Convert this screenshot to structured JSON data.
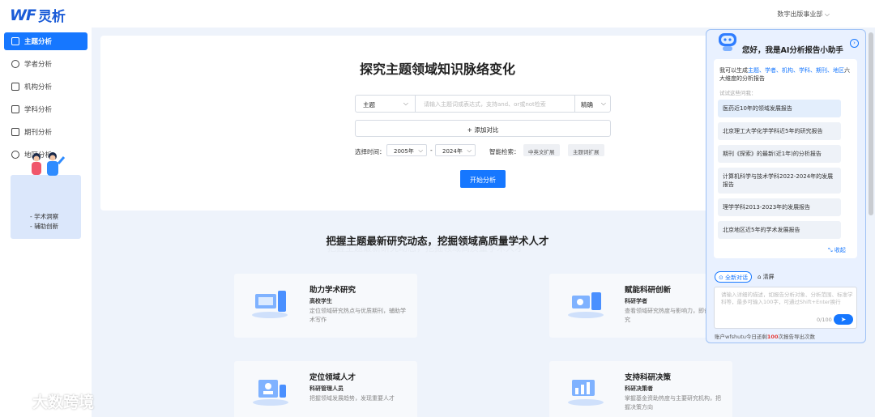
{
  "brand": {
    "logo_wf": "WF",
    "logo_cn": "灵析"
  },
  "header": {
    "dept": "数字出版事业部 ⌵"
  },
  "sidebar": {
    "items": [
      {
        "label": "主题分析",
        "active": true
      },
      {
        "label": "学者分析"
      },
      {
        "label": "机构分析"
      },
      {
        "label": "学科分析"
      },
      {
        "label": "期刊分析"
      },
      {
        "label": "地区分析"
      }
    ],
    "promo": {
      "line1": "- 学术洞察",
      "line2": "- 辅助创新"
    }
  },
  "main": {
    "title": "探究主题领域知识脉络变化",
    "search": {
      "field": "主题",
      "placeholder": "请输入主题词或表达式，支持and、or或not检索",
      "match": "精确"
    },
    "add_compare": "+ 添加对比",
    "time_label": "选择时间：",
    "year_start": "2005年",
    "year_dash": "-",
    "year_end": "2024年",
    "smart_label": "智能检索：",
    "tag1": "中英文扩展",
    "tag2": "主题词扩展",
    "start": "开始分析"
  },
  "section": {
    "title": "把握主题最新研究动态，挖掘领域高质量学术人才",
    "ghost": "把握主题最新研究动态，挖掘领域高质量学术人才"
  },
  "features": [
    {
      "title": "助力学术研究",
      "sub": "高校学生",
      "desc": "定位领域研究热点与优质期刊，辅助学术写作"
    },
    {
      "title": "赋能科研创新",
      "sub": "科研学者",
      "desc": "查看领域研究热度与影响力，即创新研究"
    },
    {
      "title": "定位领域人才",
      "sub": "科研管理人员",
      "desc": "把握领域发展趋势，发现重要人才"
    },
    {
      "title": "支持科研决策",
      "sub": "科研决策者",
      "desc": "掌握基金资助热度与主要研究机构，把握决策方向"
    }
  ],
  "watermark": "大数跨境",
  "ai": {
    "greeting": "您好，我是AI分析报告小助手",
    "intro_pre": "我可以生成",
    "intro_hl1": "主题、学者、机构、学科、期刊、",
    "intro_hl2": "地区",
    "intro_post": "六大维度的分析报告",
    "hint": "试试这些问我：",
    "suggestions": [
      "医药近10年的领域发展报告",
      "北京理工大学化学学科近5年的研究报告",
      "期刊《探索》的最新(近1年)的分析报告",
      "计算机科学与技术学科2022-2024年的发展报告",
      "理学学科2013-2023年的发展报告",
      "北京地区近5年的学术发展报告"
    ],
    "collapse": "⤡ 收起",
    "new_chat": "⊙ 全新对话",
    "clear": "⌂ 清屏",
    "input_placeholder": "请输入详细的描述，如报告分析对象、分析范围、标准学科等，最多可输入100字，可通过Shift+Enter换行",
    "count": "0/100",
    "quota_pre": "账户wfshutu今日还剩",
    "quota_num": "100",
    "quota_post": "次报告导出次数"
  }
}
